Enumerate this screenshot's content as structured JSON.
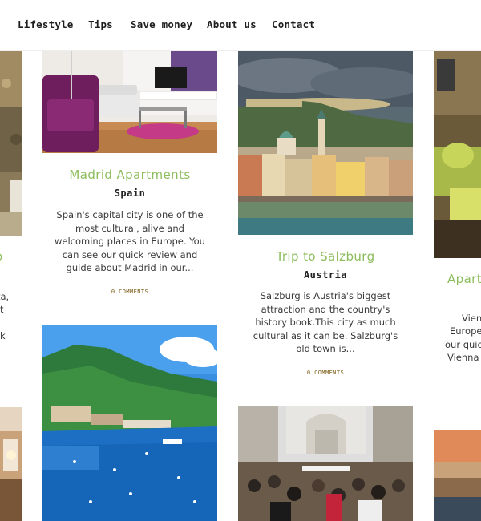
{
  "nav": {
    "items": [
      {
        "label": "Lifestyle"
      },
      {
        "label": "Tips"
      },
      {
        "label": "Save money"
      },
      {
        "label": "About us"
      },
      {
        "label": "Contact"
      }
    ]
  },
  "colors": {
    "title_green": "#8cbd5c",
    "comments_brown": "#7a5a14",
    "background": "#f7f7f7"
  },
  "posts": {
    "madrid": {
      "title": "Madrid Apartments",
      "subtitle": "Spain",
      "excerpt_lines": [
        "Spain's capital city is one of the",
        "most cultural, alive and",
        "welcoming places in Europe. You",
        "can see our quick review and",
        "guide about Madrid in our..."
      ],
      "comments": "0 COMMENTS",
      "image_icon": "living-room-photo"
    },
    "salzburg": {
      "title": "Trip to Salzburg",
      "subtitle": "Austria",
      "excerpt_lines": [
        "Salzburg is Austria's biggest",
        "attraction and the country's",
        "history book.This city as much",
        "cultural as it can be. Salzburg's",
        "old town is..."
      ],
      "comments": "0 COMMENTS",
      "image_icon": "salzburg-city-photo"
    },
    "nice": {
      "image_icon": "coastal-harbor-photo"
    },
    "crowd": {
      "image_icon": "street-crowd-photo"
    },
    "left_partial": {
      "title_fragment": "o",
      "lines": [
        "ta,",
        "t",
        "",
        "k"
      ]
    },
    "right_partial": {
      "title_fragment": "Apart",
      "lines": [
        "Vien",
        "Europe",
        "our quic",
        "Vienna"
      ]
    }
  }
}
